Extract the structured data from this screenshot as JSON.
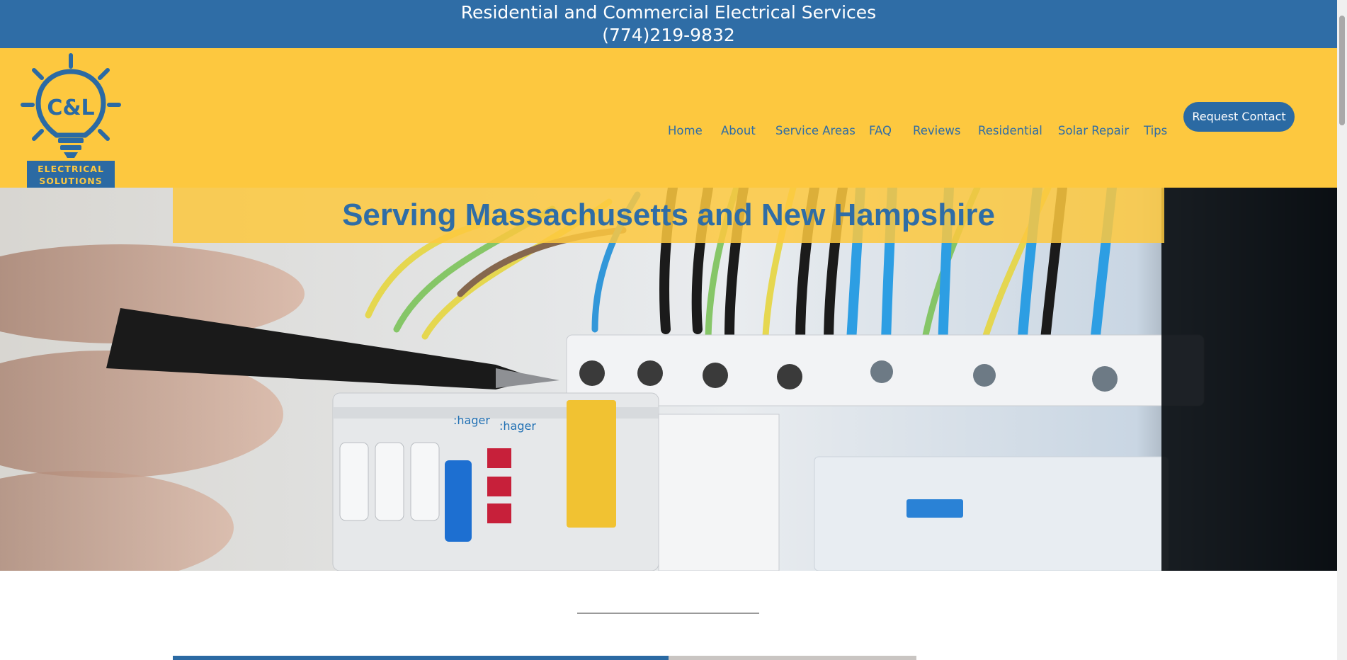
{
  "topbar": {
    "tagline": "Residential and Commercial Electrical Services",
    "phone": "(774)219-9832"
  },
  "logo": {
    "monogram": "C&L",
    "line1": "ELECTRICAL",
    "line2": "SOLUTIONS"
  },
  "nav": {
    "items": [
      {
        "label": "Home"
      },
      {
        "label": "About"
      },
      {
        "label": "Service Areas"
      },
      {
        "label": "FAQ"
      },
      {
        "label": "Reviews"
      },
      {
        "label": "Residential"
      },
      {
        "label": "Solar Repair"
      },
      {
        "label": "Tips"
      }
    ],
    "cta_label": "Request Contact"
  },
  "hero": {
    "title": "Serving Massachusetts and New Hampshire"
  },
  "colors": {
    "brand_blue": "#2f6da6",
    "brand_yellow": "#fdc83f"
  }
}
